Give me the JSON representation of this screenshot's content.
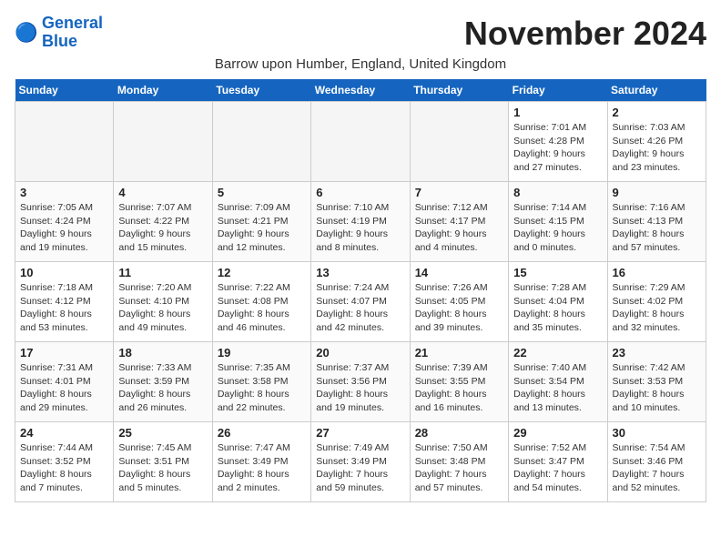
{
  "logo": {
    "line1": "General",
    "line2": "Blue"
  },
  "title": "November 2024",
  "subtitle": "Barrow upon Humber, England, United Kingdom",
  "days_of_week": [
    "Sunday",
    "Monday",
    "Tuesday",
    "Wednesday",
    "Thursday",
    "Friday",
    "Saturday"
  ],
  "weeks": [
    [
      {
        "day": "",
        "empty": true
      },
      {
        "day": "",
        "empty": true
      },
      {
        "day": "",
        "empty": true
      },
      {
        "day": "",
        "empty": true
      },
      {
        "day": "",
        "empty": true
      },
      {
        "day": "1",
        "sunrise": "7:01 AM",
        "sunset": "4:28 PM",
        "daylight": "9 hours and 27 minutes."
      },
      {
        "day": "2",
        "sunrise": "7:03 AM",
        "sunset": "4:26 PM",
        "daylight": "9 hours and 23 minutes."
      }
    ],
    [
      {
        "day": "3",
        "sunrise": "7:05 AM",
        "sunset": "4:24 PM",
        "daylight": "9 hours and 19 minutes."
      },
      {
        "day": "4",
        "sunrise": "7:07 AM",
        "sunset": "4:22 PM",
        "daylight": "9 hours and 15 minutes."
      },
      {
        "day": "5",
        "sunrise": "7:09 AM",
        "sunset": "4:21 PM",
        "daylight": "9 hours and 12 minutes."
      },
      {
        "day": "6",
        "sunrise": "7:10 AM",
        "sunset": "4:19 PM",
        "daylight": "9 hours and 8 minutes."
      },
      {
        "day": "7",
        "sunrise": "7:12 AM",
        "sunset": "4:17 PM",
        "daylight": "9 hours and 4 minutes."
      },
      {
        "day": "8",
        "sunrise": "7:14 AM",
        "sunset": "4:15 PM",
        "daylight": "9 hours and 0 minutes."
      },
      {
        "day": "9",
        "sunrise": "7:16 AM",
        "sunset": "4:13 PM",
        "daylight": "8 hours and 57 minutes."
      }
    ],
    [
      {
        "day": "10",
        "sunrise": "7:18 AM",
        "sunset": "4:12 PM",
        "daylight": "8 hours and 53 minutes."
      },
      {
        "day": "11",
        "sunrise": "7:20 AM",
        "sunset": "4:10 PM",
        "daylight": "8 hours and 49 minutes."
      },
      {
        "day": "12",
        "sunrise": "7:22 AM",
        "sunset": "4:08 PM",
        "daylight": "8 hours and 46 minutes."
      },
      {
        "day": "13",
        "sunrise": "7:24 AM",
        "sunset": "4:07 PM",
        "daylight": "8 hours and 42 minutes."
      },
      {
        "day": "14",
        "sunrise": "7:26 AM",
        "sunset": "4:05 PM",
        "daylight": "8 hours and 39 minutes."
      },
      {
        "day": "15",
        "sunrise": "7:28 AM",
        "sunset": "4:04 PM",
        "daylight": "8 hours and 35 minutes."
      },
      {
        "day": "16",
        "sunrise": "7:29 AM",
        "sunset": "4:02 PM",
        "daylight": "8 hours and 32 minutes."
      }
    ],
    [
      {
        "day": "17",
        "sunrise": "7:31 AM",
        "sunset": "4:01 PM",
        "daylight": "8 hours and 29 minutes."
      },
      {
        "day": "18",
        "sunrise": "7:33 AM",
        "sunset": "3:59 PM",
        "daylight": "8 hours and 26 minutes."
      },
      {
        "day": "19",
        "sunrise": "7:35 AM",
        "sunset": "3:58 PM",
        "daylight": "8 hours and 22 minutes."
      },
      {
        "day": "20",
        "sunrise": "7:37 AM",
        "sunset": "3:56 PM",
        "daylight": "8 hours and 19 minutes."
      },
      {
        "day": "21",
        "sunrise": "7:39 AM",
        "sunset": "3:55 PM",
        "daylight": "8 hours and 16 minutes."
      },
      {
        "day": "22",
        "sunrise": "7:40 AM",
        "sunset": "3:54 PM",
        "daylight": "8 hours and 13 minutes."
      },
      {
        "day": "23",
        "sunrise": "7:42 AM",
        "sunset": "3:53 PM",
        "daylight": "8 hours and 10 minutes."
      }
    ],
    [
      {
        "day": "24",
        "sunrise": "7:44 AM",
        "sunset": "3:52 PM",
        "daylight": "8 hours and 7 minutes."
      },
      {
        "day": "25",
        "sunrise": "7:45 AM",
        "sunset": "3:51 PM",
        "daylight": "8 hours and 5 minutes."
      },
      {
        "day": "26",
        "sunrise": "7:47 AM",
        "sunset": "3:49 PM",
        "daylight": "8 hours and 2 minutes."
      },
      {
        "day": "27",
        "sunrise": "7:49 AM",
        "sunset": "3:49 PM",
        "daylight": "7 hours and 59 minutes."
      },
      {
        "day": "28",
        "sunrise": "7:50 AM",
        "sunset": "3:48 PM",
        "daylight": "7 hours and 57 minutes."
      },
      {
        "day": "29",
        "sunrise": "7:52 AM",
        "sunset": "3:47 PM",
        "daylight": "7 hours and 54 minutes."
      },
      {
        "day": "30",
        "sunrise": "7:54 AM",
        "sunset": "3:46 PM",
        "daylight": "7 hours and 52 minutes."
      }
    ]
  ]
}
